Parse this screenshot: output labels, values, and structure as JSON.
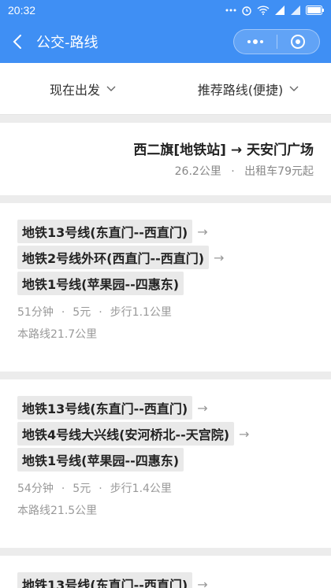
{
  "status_bar": {
    "time": "20:32"
  },
  "header": {
    "title": "公交-路线"
  },
  "filters": {
    "depart": "现在出发",
    "sort": "推荐路线(便捷)"
  },
  "summary": {
    "route": "西二旗[地铁站] → 天安门广场",
    "distance": "26.2公里",
    "taxi": "出租车79元起",
    "separator": "·"
  },
  "arrow": "→",
  "routes": [
    {
      "lines": [
        "地铁13号线(东直门--西直门)",
        "地铁2号线外环(西直门--西直门)",
        "地铁1号线(苹果园--四惠东)"
      ],
      "duration": "51分钟",
      "price": "5元",
      "walk": "步行1.1公里",
      "distance": "本路线21.7公里"
    },
    {
      "lines": [
        "地铁13号线(东直门--西直门)",
        "地铁4号线大兴线(安河桥北--天宫院)",
        "地铁1号线(苹果园--四惠东)"
      ],
      "duration": "54分钟",
      "price": "5元",
      "walk": "步行1.4公里",
      "distance": "本路线21.5公里"
    },
    {
      "lines": [
        "地铁13号线(东直门--西直门)"
      ]
    }
  ]
}
